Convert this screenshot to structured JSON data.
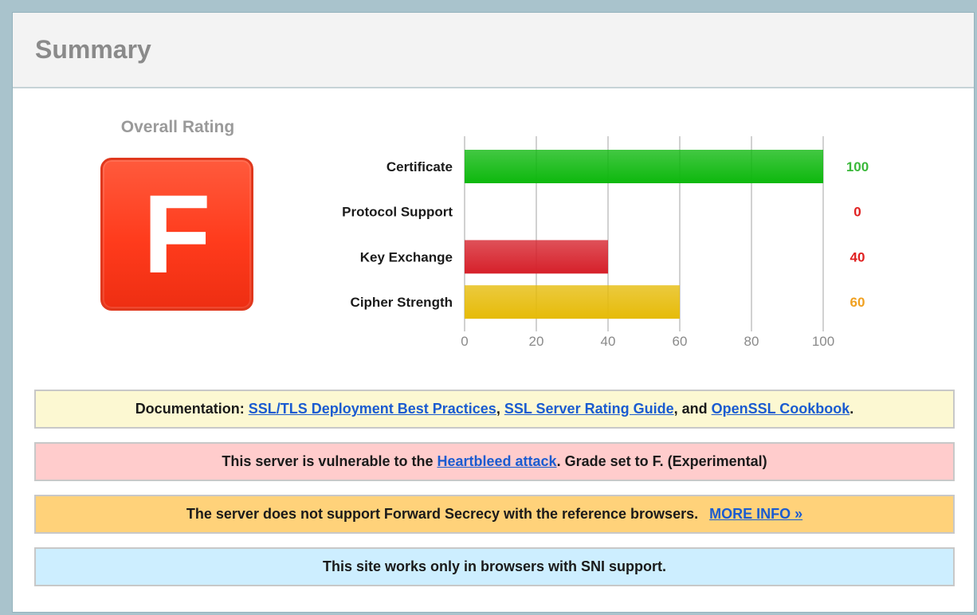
{
  "summary": {
    "title": "Summary",
    "overall_rating_label": "Overall Rating",
    "grade": "F",
    "grade_color": "#ff3b1c"
  },
  "chart_data": {
    "type": "bar",
    "orientation": "horizontal",
    "categories": [
      "Certificate",
      "Protocol Support",
      "Key Exchange",
      "Cipher Strength"
    ],
    "values": [
      100,
      0,
      40,
      60
    ],
    "value_labels": [
      "100",
      "0",
      "40",
      "60"
    ],
    "bar_colors": [
      "#0db80d",
      "#cccccc",
      "#d6202a",
      "#e6bb08"
    ],
    "label_colors": [
      "#3ab83a",
      "#e02020",
      "#e02020",
      "#f0a020"
    ],
    "xlim": [
      0,
      100
    ],
    "xticks": [
      0,
      20,
      40,
      60,
      80,
      100
    ],
    "xtick_labels": [
      "0",
      "20",
      "40",
      "60",
      "80",
      "100"
    ],
    "grid": true
  },
  "notices": {
    "documentation": {
      "prefix": "Documentation: ",
      "link1": "SSL/TLS Deployment Best Practices",
      "sep1": ", ",
      "link2": "SSL Server Rating Guide",
      "sep2": ", and ",
      "link3": "OpenSSL Cookbook",
      "suffix": "."
    },
    "heartbleed": {
      "prefix": "This server is vulnerable to the ",
      "link": "Heartbleed attack",
      "suffix": ". Grade set to F. (Experimental)"
    },
    "forward_secrecy": {
      "text": "The server does not support Forward Secrecy with the reference browsers.",
      "link": "MORE INFO »"
    },
    "sni": {
      "text": "This site works only in browsers with SNI support."
    }
  }
}
